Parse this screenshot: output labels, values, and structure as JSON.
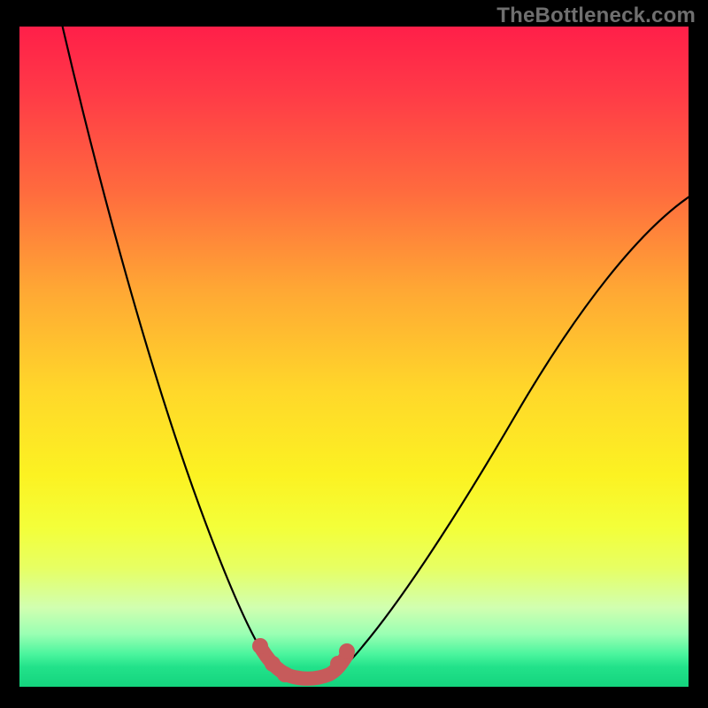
{
  "watermark": "TheBottleneck.com",
  "colors": {
    "background": "#000000",
    "gradient_top": "#ff1f49",
    "gradient_bottom": "#14d47e",
    "curve": "#000000",
    "highlight": "#c65b5b",
    "watermark_text": "#6f6f6f"
  },
  "chart_data": {
    "type": "line",
    "title": "",
    "xlabel": "",
    "ylabel": "",
    "x": [
      0.0,
      0.05,
      0.1,
      0.15,
      0.2,
      0.25,
      0.3,
      0.35,
      0.38,
      0.4,
      0.42,
      0.45,
      0.48,
      0.5,
      0.55,
      0.6,
      0.65,
      0.7,
      0.75,
      0.8,
      0.85,
      0.9,
      0.95,
      1.0
    ],
    "y": [
      1.02,
      0.82,
      0.64,
      0.48,
      0.34,
      0.22,
      0.12,
      0.05,
      0.02,
      0.01,
      0.01,
      0.02,
      0.05,
      0.09,
      0.18,
      0.27,
      0.36,
      0.44,
      0.51,
      0.57,
      0.62,
      0.66,
      0.69,
      0.7
    ],
    "xlim": [
      0,
      1
    ],
    "ylim": [
      0,
      1
    ],
    "grid": false,
    "legend": false,
    "highlight_region": {
      "x_start": 0.35,
      "x_end": 0.48,
      "note": "trough emphasized"
    }
  }
}
